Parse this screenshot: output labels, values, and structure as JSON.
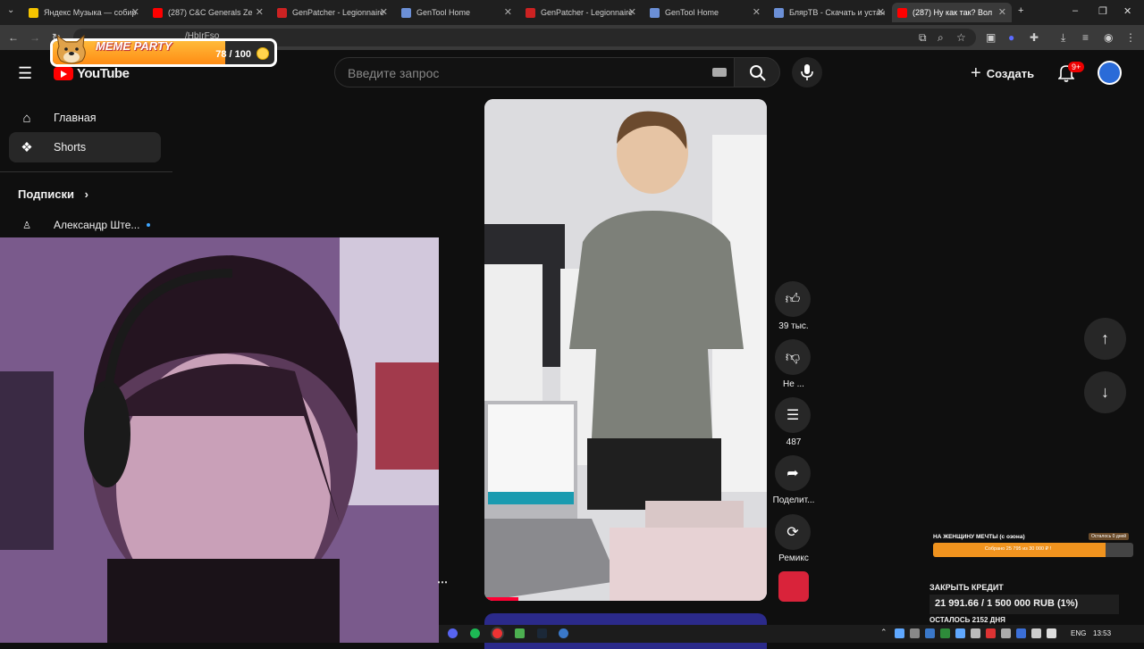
{
  "browser": {
    "tabs": [
      {
        "title": "Яндекс Музыка — собир",
        "color": "#f5c400"
      },
      {
        "title": "(287) C&C Generals Ze",
        "color": "#ff0000"
      },
      {
        "title": "GenPatcher - Legionnaire",
        "color": "#cc2222"
      },
      {
        "title": "GenTool Home",
        "color": "#6b8fd6"
      },
      {
        "title": "GenPatcher - Legionnaire",
        "color": "#cc2222"
      },
      {
        "title": "GenTool Home",
        "color": "#6b8fd6"
      },
      {
        "title": "БлярТВ - Скачать и устан",
        "color": "#6b8fd6"
      },
      {
        "title": "(287) Ну как так? Вол",
        "color": "#ff0000"
      }
    ],
    "url_fragment": "/HbIrFso"
  },
  "overlay": {
    "meme_title": "MEME PARTY",
    "meme_value": "78 / 100",
    "meme_progress": 0.78
  },
  "youtube": {
    "logo": "YouTube",
    "search_placeholder": "Введите запрос",
    "create_label": "Создать",
    "notif_badge": "9+",
    "sidebar": {
      "home": "Главная",
      "shorts": "Shorts",
      "subscriptions": "Подписки",
      "sub_channel": "Александр Ште..."
    },
    "actions": {
      "likes": "39 тыс.",
      "dislike": "Не ...",
      "comments": "487",
      "share": "Поделит...",
      "remix": "Ремикс"
    }
  },
  "widgets": {
    "goal_title": "НА ЖЕНЩИНУ МЕЧТЫ (с озона)",
    "goal_days": "Осталось 0 дней",
    "goal_text": "Собрано 25 795 из 30 000 ₽ !",
    "goal_progress": 0.86,
    "credit_title": "ЗАКРЫТЬ КРЕДИТ",
    "credit_value": "21 991.66 / 1 500 000 RUB (1%)",
    "credit_days": "ОСТАЛОСЬ 2152 ДНЯ"
  },
  "taskbar": {
    "lang": "ENG",
    "clock": "13:53"
  }
}
